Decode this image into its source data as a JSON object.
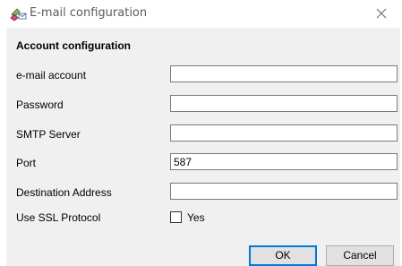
{
  "window": {
    "title": "E-mail configuration",
    "icon": "email-settings-icon",
    "close_icon": "close-icon"
  },
  "section": {
    "title": "Account configuration"
  },
  "fields": [
    {
      "label": "e-mail account",
      "value": ""
    },
    {
      "label": "Password",
      "value": ""
    },
    {
      "label": "SMTP Server",
      "value": ""
    },
    {
      "label": "Port",
      "value": "587"
    },
    {
      "label": "Destination Address",
      "value": ""
    }
  ],
  "ssl": {
    "label": "Use SSL Protocol",
    "checkbox_label": "Yes",
    "checked": false
  },
  "buttons": {
    "ok": "OK",
    "cancel": "Cancel"
  },
  "colors": {
    "accent": "#0078d7",
    "client_bg": "#f0f0f0"
  }
}
